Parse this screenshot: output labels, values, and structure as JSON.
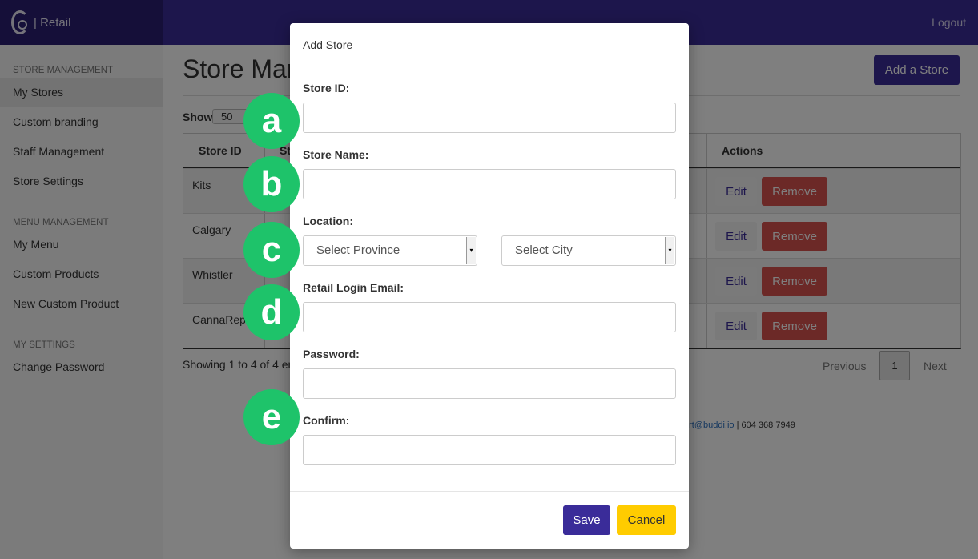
{
  "header": {
    "brand": "| Retail",
    "logout": "Logout"
  },
  "sidebar": {
    "sections": [
      {
        "title": "STORE MANAGEMENT",
        "items": [
          "My Stores",
          "Custom branding",
          "Staff Management",
          "Store Settings"
        ]
      },
      {
        "title": "MENU MANAGEMENT",
        "items": [
          "My Menu",
          "Custom Products",
          "New Custom Product"
        ]
      },
      {
        "title": "MY SETTINGS",
        "items": [
          "Change Password"
        ]
      }
    ],
    "active": "My Stores"
  },
  "main": {
    "title": "Store Mar",
    "add_button": "Add a Store",
    "show_label": "Show",
    "show_value": "50",
    "table": {
      "columns": [
        "Store ID",
        "St",
        "Actions"
      ],
      "rows": [
        {
          "id": "Kits",
          "edit": "Edit",
          "remove": "Remove"
        },
        {
          "id": "Calgary",
          "edit": "Edit",
          "remove": "Remove"
        },
        {
          "id": "Whistler",
          "edit": "Edit",
          "remove": "Remove"
        },
        {
          "id": "CannaReps",
          "edit": "Edit",
          "remove": "Remove"
        }
      ]
    },
    "showing": "Showing 1 to 4 of 4 en",
    "pagination": {
      "previous": "Previous",
      "page": "1",
      "next": "Next"
    },
    "footer": {
      "email": "ort@buddi.io",
      "phone": " | 604 368 7949"
    }
  },
  "modal": {
    "title": "Add Store",
    "fields": {
      "store_id": {
        "label": "Store ID:",
        "value": ""
      },
      "store_name": {
        "label": "Store Name:",
        "value": ""
      },
      "location": {
        "label": "Location:",
        "province": "Select Province",
        "city": "Select City"
      },
      "email": {
        "label": "Retail Login Email:",
        "value": ""
      },
      "password": {
        "label": "Password:",
        "value": ""
      },
      "confirm": {
        "label": "Confirm:",
        "value": ""
      }
    },
    "save": "Save",
    "cancel": "Cancel"
  },
  "callouts": [
    "a",
    "b",
    "c",
    "d",
    "e"
  ],
  "colors": {
    "primary": "#3a2c99",
    "danger": "#d9534f",
    "warning": "#ffcc00",
    "callout": "#1ec36a"
  }
}
